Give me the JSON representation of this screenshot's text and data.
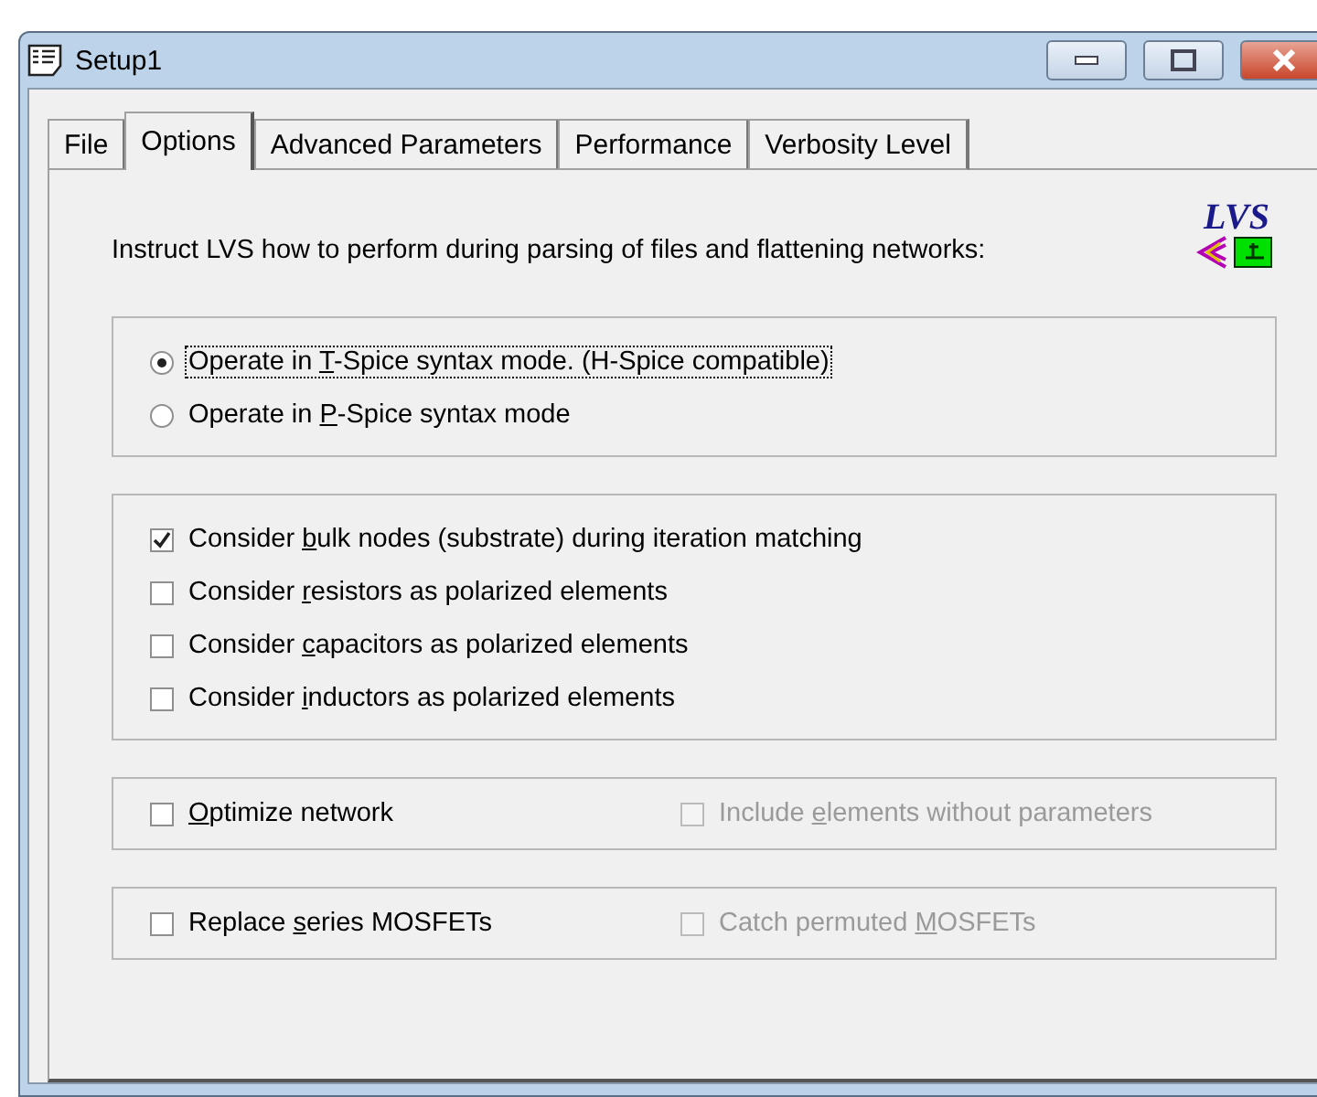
{
  "window": {
    "title": "Setup1"
  },
  "tabs": [
    {
      "label": "File",
      "selected": false
    },
    {
      "label": "Options",
      "selected": true
    },
    {
      "label": "Advanced Parameters",
      "selected": false
    },
    {
      "label": "Performance",
      "selected": false
    },
    {
      "label": "Verbosity Level",
      "selected": false
    }
  ],
  "logo": {
    "text": "LVS"
  },
  "instruction": "Instruct LVS how to perform during parsing of files and flattening networks:",
  "groups": [
    {
      "items": [
        {
          "kind": "radio",
          "before": "Operate in ",
          "key": "T",
          "after": "-Spice syntax mode. (H-Spice compatible)",
          "selected": true,
          "focused": true,
          "disabled": false
        },
        {
          "kind": "radio",
          "before": "Operate in ",
          "key": "P",
          "after": "-Spice syntax mode",
          "selected": false,
          "focused": false,
          "disabled": false
        }
      ]
    },
    {
      "items": [
        {
          "kind": "checkbox",
          "before": "Consider ",
          "key": "b",
          "after": "ulk nodes (substrate) during iteration matching",
          "checked": true,
          "disabled": false
        },
        {
          "kind": "checkbox",
          "before": "Consider ",
          "key": "r",
          "after": "esistors as polarized elements",
          "checked": false,
          "disabled": false
        },
        {
          "kind": "checkbox",
          "before": "Consider ",
          "key": "c",
          "after": "apacitors as polarized elements",
          "checked": false,
          "disabled": false
        },
        {
          "kind": "checkbox",
          "before": "Consider ",
          "key": "i",
          "after": "nductors as polarized elements",
          "checked": false,
          "disabled": false
        }
      ]
    },
    {
      "row": true,
      "items": [
        {
          "kind": "checkbox",
          "key": "O",
          "after": "ptimize network",
          "checked": false,
          "disabled": false
        },
        {
          "kind": "checkbox",
          "before": "Include ",
          "key": "e",
          "after": "lements without parameters",
          "checked": false,
          "disabled": true
        }
      ]
    },
    {
      "row": true,
      "items": [
        {
          "kind": "checkbox",
          "before": "Replace ",
          "key": "s",
          "after": "eries MOSFETs",
          "checked": false,
          "disabled": false
        },
        {
          "kind": "checkbox",
          "before": "Catch permuted ",
          "key": "M",
          "after": "OSFETs",
          "checked": false,
          "disabled": true
        }
      ]
    }
  ]
}
